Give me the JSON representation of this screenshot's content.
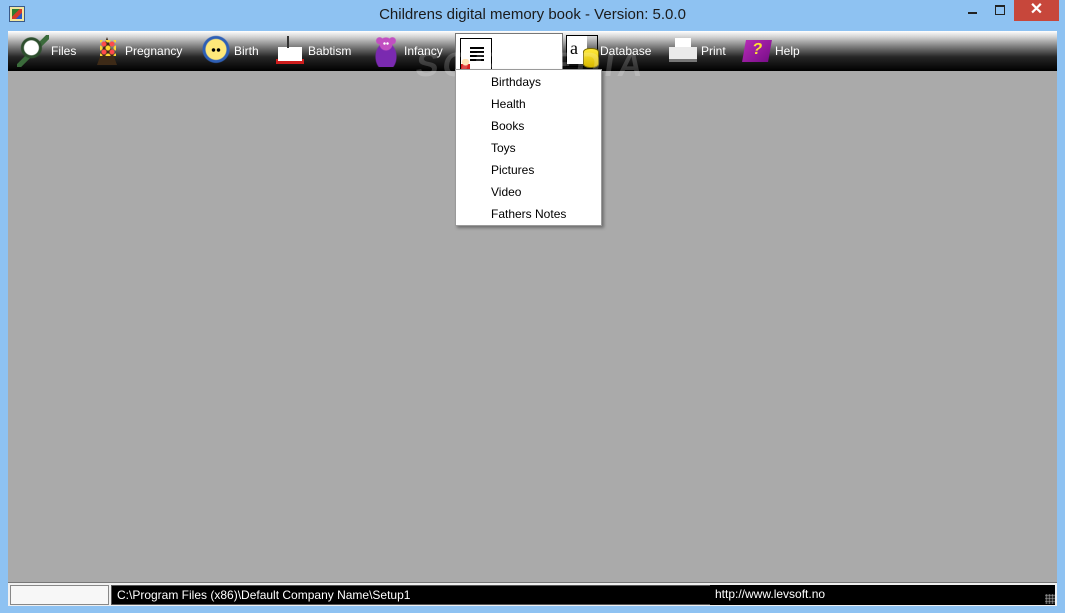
{
  "window": {
    "title": "Childrens digital memory book -  Version: 5.0.0",
    "controls": {
      "minimize": "",
      "maximize": "",
      "close": "✕"
    }
  },
  "toolbar": {
    "items": [
      {
        "id": "files",
        "label": "Files",
        "icon": "files-icon"
      },
      {
        "id": "pregnancy",
        "label": "Pregnancy",
        "icon": "pregnancy-icon"
      },
      {
        "id": "birth",
        "label": "Birth",
        "icon": "birth-icon"
      },
      {
        "id": "babtism",
        "label": "Babtism",
        "icon": "babtism-icon"
      },
      {
        "id": "infancy",
        "label": "Infancy",
        "icon": "infancy-icon"
      },
      {
        "id": "growth",
        "label": "",
        "icon": "growth-icon"
      },
      {
        "id": "database",
        "label": "Database",
        "icon": "database-icon"
      },
      {
        "id": "print",
        "label": "Print",
        "icon": "print-icon"
      },
      {
        "id": "help",
        "label": "Help",
        "icon": "help-icon"
      }
    ]
  },
  "dropdown": {
    "items": [
      "Birthdays",
      "Health",
      "Books",
      "Toys",
      "Pictures",
      "Video",
      "Fathers Notes"
    ]
  },
  "watermark": "SOFTPEDIA",
  "statusbar": {
    "panel1": "",
    "path": "C:\\Program Files (x86)\\Default Company Name\\Setup1",
    "url": "http://www.levsoft.no",
    "panel4": ""
  },
  "colors": {
    "titlebar": "#8ec2f2",
    "workspace": "#aaaaaa",
    "close_button": "#c7473b",
    "toolbar_bottom": "#000000"
  }
}
